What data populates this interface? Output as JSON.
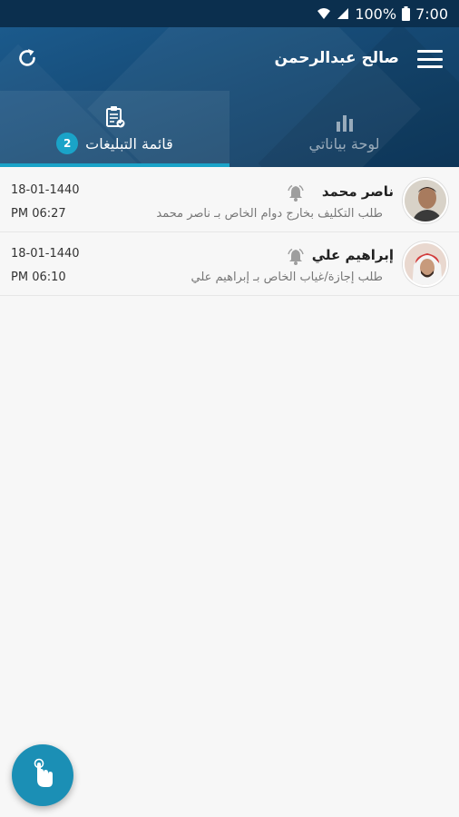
{
  "status_bar": {
    "battery": "100%",
    "time": "7:00",
    "icons": [
      "wifi-icon",
      "signal-icon",
      "battery-icon"
    ]
  },
  "header": {
    "title": "صالح عبدالرحمن",
    "icons": [
      "refresh-icon",
      "menu-icon"
    ]
  },
  "tabs": [
    {
      "label": "لوحة بياناتي",
      "icon": "bar-chart-icon",
      "active": false
    },
    {
      "label": "قائمة التبليغات",
      "icon": "clipboard-check-icon",
      "active": true,
      "badge": "2"
    }
  ],
  "notifications": [
    {
      "name": "ناصر محمد",
      "description": "طلب التكليف بخارج دوام الخاص بـ ناصر محمد",
      "date": "18-01-1440",
      "time": "PM 06:27",
      "icon": "bell-icon"
    },
    {
      "name": "إبراهيم علي",
      "description": "طلب إجازة/غياب الخاص بـ إبراهيم علي",
      "date": "18-01-1440",
      "time": "PM 06:10",
      "icon": "bell-icon"
    }
  ],
  "fab": {
    "icon": "touch-hand-icon"
  },
  "colors": {
    "status_bar": "#0b2f4e",
    "header": "#164a75",
    "accent": "#1aa3c8",
    "fab": "#1b8fb5",
    "background": "#f7f7f7"
  }
}
